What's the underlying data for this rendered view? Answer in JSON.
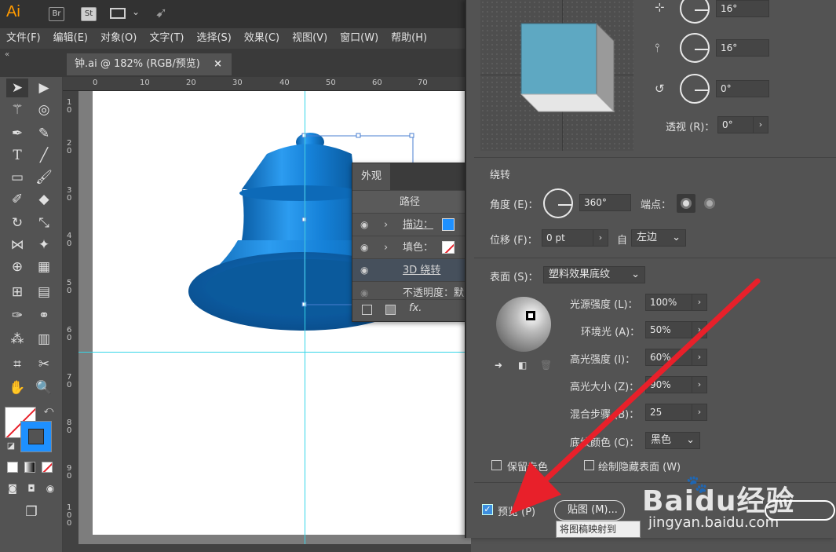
{
  "app": {
    "logo": "Ai",
    "bridge": "Br",
    "stock": "St"
  },
  "menu": [
    "文件(F)",
    "编辑(E)",
    "对象(O)",
    "文字(T)",
    "选择(S)",
    "效果(C)",
    "视图(V)",
    "窗口(W)",
    "帮助(H)"
  ],
  "document": {
    "tab_title": "钟.ai @ 182% (RGB/预览)",
    "close": "×",
    "zoom_partial": "182%"
  },
  "ruler": {
    "top": [
      "0",
      "10",
      "20",
      "30",
      "40",
      "50",
      "60",
      "70"
    ],
    "left": [
      "1\n0",
      "2\n0",
      "3\n0",
      "4\n0",
      "5\n0",
      "6\n0",
      "7\n0",
      "8\n0",
      "9\n0",
      "1\n0\n0"
    ]
  },
  "appearance": {
    "tab": "外观",
    "header": "路径",
    "rows": [
      {
        "label": "描边：",
        "kind": "stroke"
      },
      {
        "label": "填色：",
        "kind": "fill"
      },
      {
        "label": "3D 绕转",
        "kind": "effect"
      },
      {
        "label": "不透明度：默",
        "kind": "opacity"
      }
    ],
    "footer_fx": "fx."
  },
  "dialog": {
    "rot_x": "16°",
    "rot_y": "16°",
    "rot_z": "0°",
    "perspective_label": "透视 (R)：",
    "perspective_value": "0°",
    "revolve_section": "绕转",
    "angle_label": "角度 (E)：",
    "angle_value": "360°",
    "cap_label": "端点：",
    "offset_label": "位移 (F)：",
    "offset_value": "0 pt",
    "from_label": "自",
    "from_value": "左边",
    "surface_label": "表面 (S)：",
    "surface_value": "塑料效果底纹",
    "light_intensity_label": "光源强度 (L)：",
    "light_intensity_value": "100%",
    "ambient_label": "环境光 (A)：",
    "ambient_value": "50%",
    "highlight_intensity_label": "高光强度 (I)：",
    "highlight_intensity_value": "60%",
    "highlight_size_label": "高光大小 (Z)：",
    "highlight_size_value": "90%",
    "blend_steps_label": "混合步骤 (B)：",
    "blend_steps_value": "25",
    "shade_color_label": "底纹颜色 (C)：",
    "shade_color_value": "黑色",
    "preserve_label": "保留专色",
    "draw_hidden_label": "绘制隐藏表面 (W)",
    "preview_label": "预览 (P)",
    "map_art_label": "贴图 (M)...",
    "tooltip": "将图稿映射到"
  },
  "watermark": {
    "brand": "Baidu经验",
    "url": "jingyan.baidu.com"
  },
  "colors": {
    "bell": "#1f86d6",
    "cube_front": "#5ea8c2",
    "arrow": "#e8202a",
    "guide": "#35d6e8",
    "stroke_swatch": "#1e90ff"
  }
}
